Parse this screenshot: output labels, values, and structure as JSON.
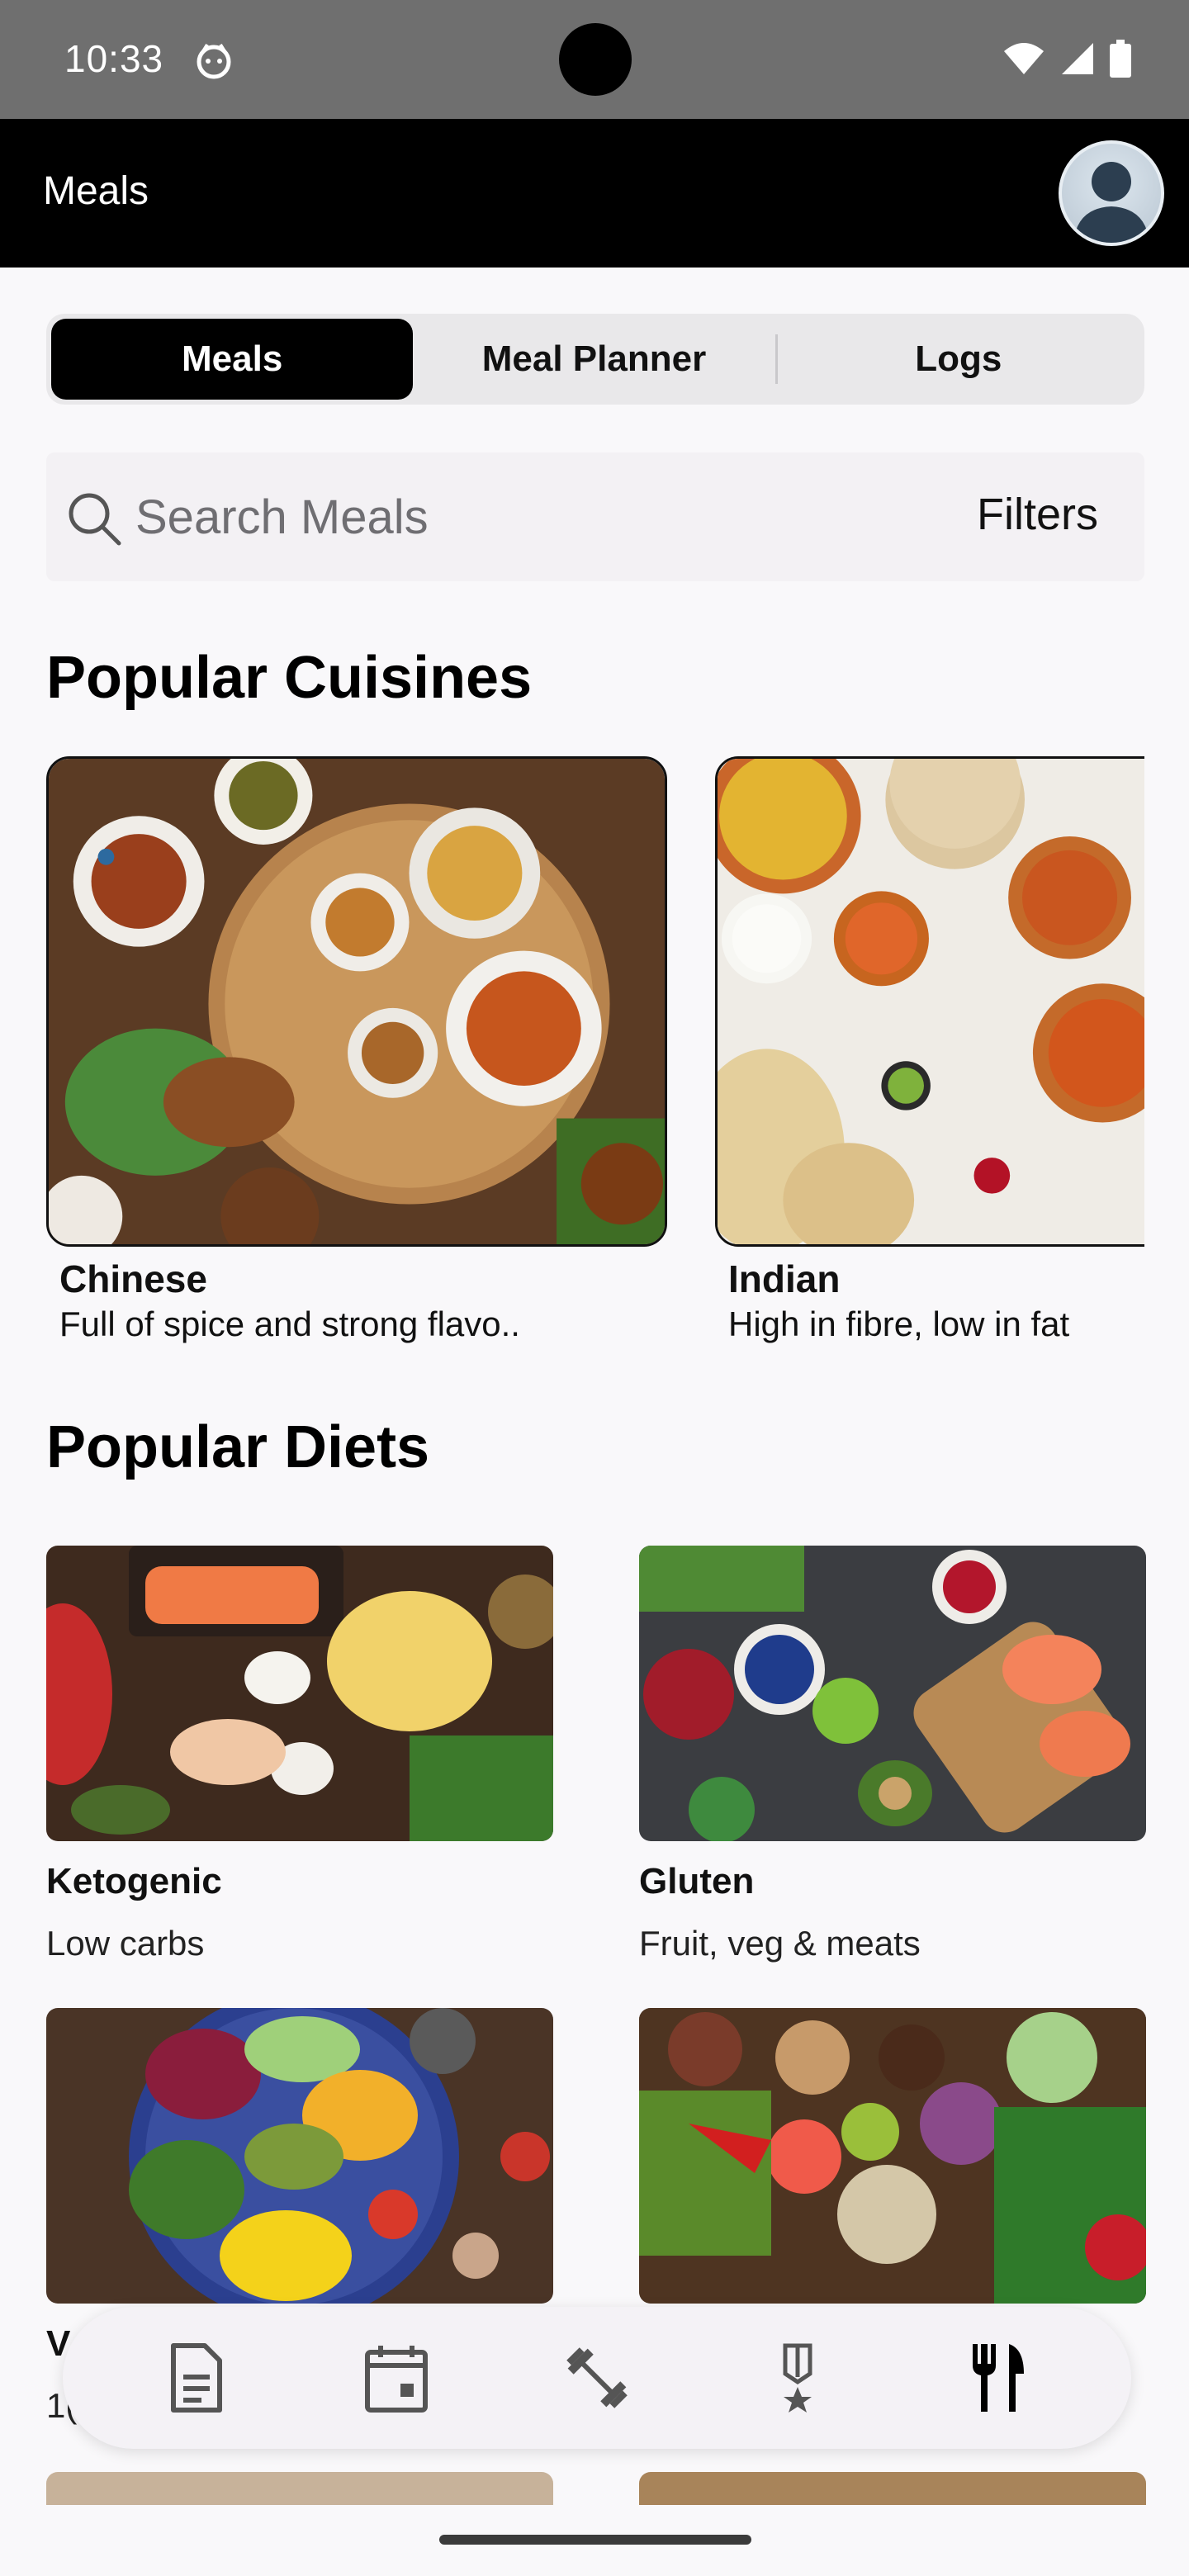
{
  "status_bar": {
    "time": "10:33",
    "icons": [
      "face-emoji-icon",
      "wifi-icon",
      "signal-icon",
      "battery-icon"
    ]
  },
  "app_bar": {
    "title": "Meals",
    "avatar_icon": "user-avatar-icon"
  },
  "tabs": [
    {
      "label": "Meals",
      "active": true
    },
    {
      "label": "Meal Planner",
      "active": false
    },
    {
      "label": "Logs",
      "active": false
    }
  ],
  "search": {
    "placeholder": "Search Meals",
    "value": "",
    "filters_label": "Filters"
  },
  "popular_cuisines": {
    "title": "Popular Cuisines",
    "items": [
      {
        "name": "Chinese",
        "description": "Full of spice and strong flavo.."
      },
      {
        "name": "Indian",
        "description": "High in fibre, low in fat"
      }
    ]
  },
  "popular_diets": {
    "title": "Popular Diets",
    "items": [
      {
        "name": "Ketogenic",
        "description": "Low carbs"
      },
      {
        "name": "Gluten",
        "description": "Fruit, veg & meats"
      },
      {
        "name": "V",
        "description": "1("
      },
      {
        "name": "",
        "description": ""
      }
    ]
  },
  "bottom_nav": [
    {
      "icon": "document-icon",
      "active": false
    },
    {
      "icon": "calendar-icon",
      "active": false
    },
    {
      "icon": "dumbbell-icon",
      "active": false
    },
    {
      "icon": "medal-icon",
      "active": false
    },
    {
      "icon": "fork-knife-icon",
      "active": true
    }
  ],
  "colors": {
    "app_bar": "#000000",
    "status_bar": "#6f6f6f",
    "background": "#f9f8fa",
    "tab_active": "#000000"
  }
}
